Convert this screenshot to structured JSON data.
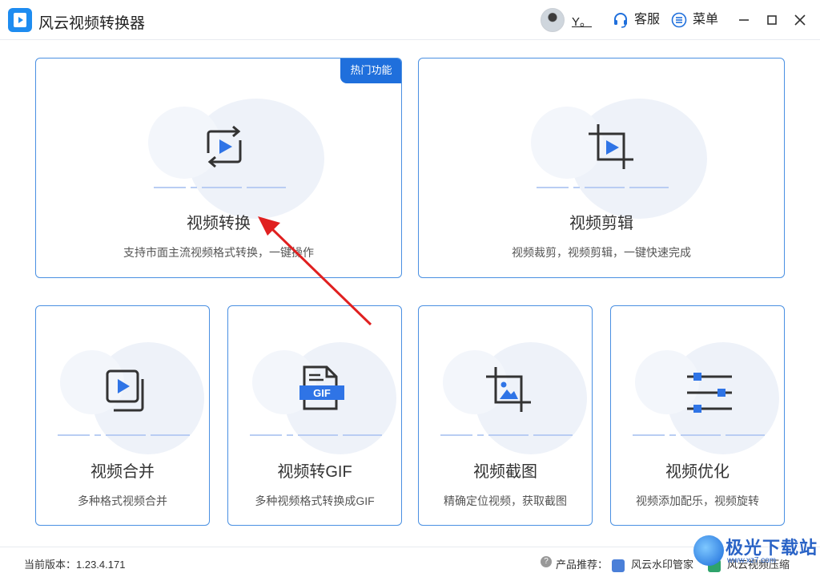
{
  "app": {
    "title": "风云视频转换器"
  },
  "header": {
    "user_name": "Y。",
    "service_label": "客服",
    "menu_label": "菜单"
  },
  "cards": [
    {
      "title": "视频转换",
      "desc": "支持市面主流视频格式转换，一键操作",
      "badge": "热门功能",
      "icon": "convert-video-icon"
    },
    {
      "title": "视频剪辑",
      "desc": "视频裁剪，视频剪辑，一键快速完成",
      "icon": "crop-video-icon"
    },
    {
      "title": "视频合并",
      "desc": "多种格式视频合并",
      "icon": "merge-video-icon"
    },
    {
      "title": "视频转GIF",
      "desc": "多种视频格式转换成GIF",
      "icon": "gif-file-icon",
      "icon_text": "GIF"
    },
    {
      "title": "视频截图",
      "desc": "精确定位视频，获取截图",
      "icon": "crop-image-icon"
    },
    {
      "title": "视频优化",
      "desc": "视频添加配乐，视频旋转",
      "icon": "sliders-icon"
    }
  ],
  "footer": {
    "version_label": "当前版本：1.23.4.171",
    "recommend_label": "产品推荐：",
    "products": [
      "风云水印管家",
      "风云视频压缩"
    ]
  },
  "watermark": {
    "text": "极光下载站",
    "url": "www.xz7.com"
  },
  "colors": {
    "accent": "#1f6fdc",
    "card_border": "#4a90e2",
    "arrow": "#e02020"
  }
}
